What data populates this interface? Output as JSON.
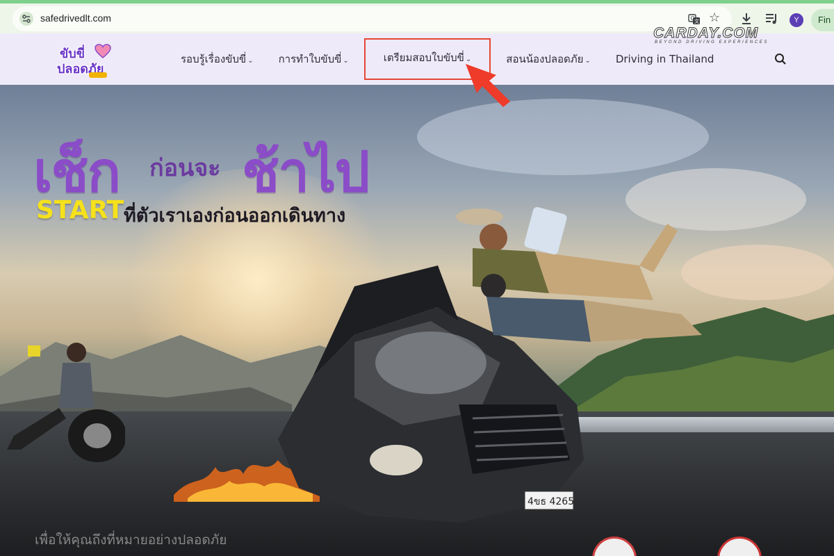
{
  "browser": {
    "url": "safedrivedlt.com",
    "profile_initial": "Y",
    "finish_label": "Fin",
    "icons": [
      "site-info-icon",
      "translate-icon",
      "star-icon",
      "download-icon",
      "media-control-icon",
      "profile-avatar"
    ]
  },
  "watermark": {
    "main": "CARDAY.COM",
    "sub": "BEYOND DRIVING EXPERIENCES"
  },
  "site": {
    "logo": {
      "line1": "ขับขี่",
      "line2": "ปลอดภัย"
    },
    "nav": [
      {
        "label": "รอบรู้เรื่องขับขี่",
        "has_dropdown": true
      },
      {
        "label": "การทำใบขับขี่",
        "has_dropdown": true
      },
      {
        "label": "เตรียมสอบใบขับขี่",
        "has_dropdown": true,
        "highlighted": true
      },
      {
        "label": "สอนน้องปลอดภัย",
        "has_dropdown": true
      },
      {
        "label": "Driving in Thailand",
        "has_dropdown": false
      }
    ],
    "caret": "⌄"
  },
  "hero": {
    "headline_part1": "เช็ก",
    "headline_part2": "ก่อนจะ",
    "headline_part3": "ช้าไป",
    "start_word": "START",
    "start_rest": "ที่ตัวเราเองก่อนออกเดินทาง",
    "caption": "เพื่อให้คุณถึงที่หมายอย่างปลอดภัย",
    "plate_number": "4ขธ 4265"
  },
  "colors": {
    "highlight_border": "#e64535",
    "brand_purple": "#8b4cc8",
    "start_yellow": "#f5e11c",
    "header_bg": "#efeaf9"
  }
}
